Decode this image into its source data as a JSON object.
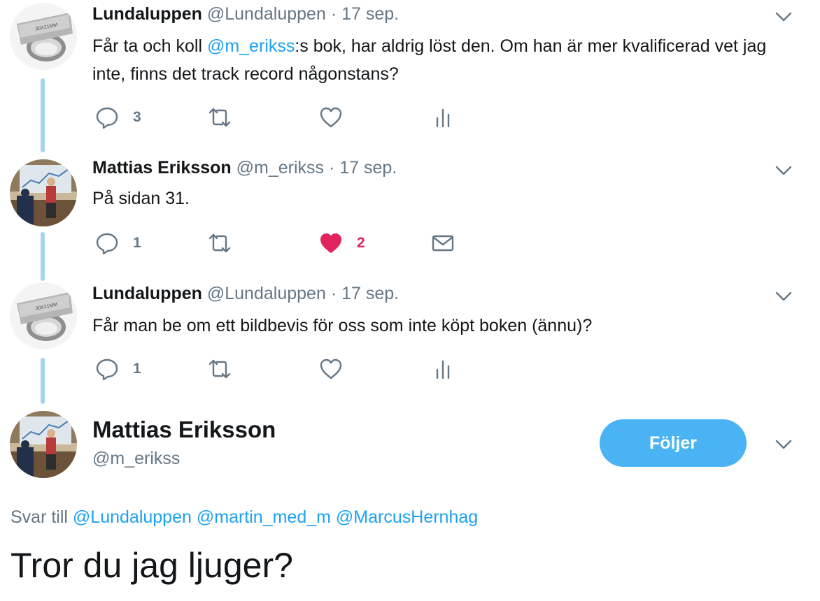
{
  "tweets": [
    {
      "name": "Lundaluppen",
      "handle": "@Lundaluppen",
      "separator": "·",
      "time": "17 sep.",
      "avatar_icon": "magnifier-loupe",
      "avatar_label": "30X21MM",
      "text_before": "Får ta och koll ",
      "mention": "@m_erikss",
      "text_after": ":s bok, har aldrig löst den. Om han är mer kvalificerad vet jag inte, finns det track record någonstans?",
      "actions": {
        "reply": "3",
        "retweet": "",
        "like": "",
        "last_icon": "analytics-icon"
      }
    },
    {
      "name": "Mattias Eriksson",
      "handle": "@m_erikss",
      "separator": "·",
      "time": "17 sep.",
      "avatar_icon": "person-photo",
      "text": "På sidan 31.",
      "actions": {
        "reply": "1",
        "retweet": "",
        "like": "2",
        "liked": true,
        "last_icon": "message-icon"
      }
    },
    {
      "name": "Lundaluppen",
      "handle": "@Lundaluppen",
      "separator": "·",
      "time": "17 sep.",
      "avatar_icon": "magnifier-loupe",
      "avatar_label": "30X21MM",
      "text": "Får man be om ett bildbevis för oss som inte köpt boken (ännu)?",
      "actions": {
        "reply": "1",
        "retweet": "",
        "like": "",
        "last_icon": "analytics-icon"
      }
    }
  ],
  "main_tweet": {
    "name": "Mattias Eriksson",
    "handle": "@m_erikss",
    "follow_label": "Följer",
    "reply_prefix": "Svar till",
    "reply_mentions": [
      "@Lundaluppen",
      "@martin_med_m",
      "@MarcusHernhag"
    ],
    "text": "Tror du jag ljuger?"
  },
  "colors": {
    "accent": "#1da1f2",
    "like": "#e0245e",
    "thread_line": "#a7d3f2",
    "follow_button": "#4ab3f4"
  }
}
